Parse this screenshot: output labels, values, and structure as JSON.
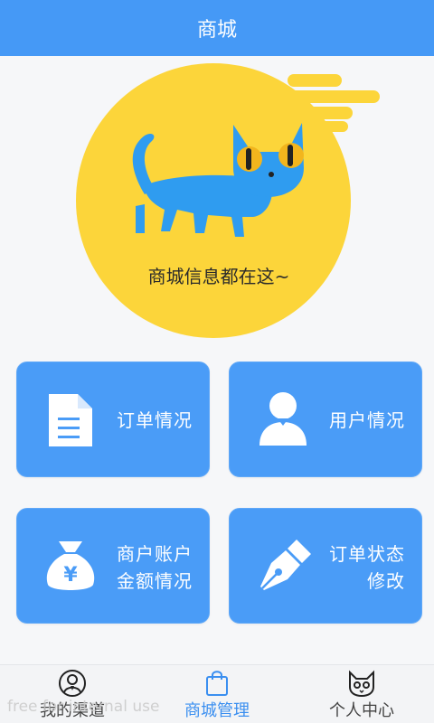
{
  "header": {
    "title": "商城"
  },
  "hero": {
    "caption": "商城信息都在这~"
  },
  "cards": [
    {
      "id": "orders",
      "icon": "document-icon",
      "lines": [
        "订单情况"
      ]
    },
    {
      "id": "users",
      "icon": "user-icon",
      "lines": [
        "用户情况"
      ]
    },
    {
      "id": "merchant",
      "icon": "money-bag-icon",
      "lines": [
        "商户账户",
        "金额情况"
      ]
    },
    {
      "id": "order-status",
      "icon": "pen-nib-icon",
      "lines": [
        "订单状态",
        "修改"
      ]
    }
  ],
  "tabbar": {
    "tabs": [
      {
        "label": "我的渠道",
        "icon": "agent-avatar-icon",
        "active": false
      },
      {
        "label": "商城管理",
        "icon": "shopping-bag-icon",
        "active": true
      },
      {
        "label": "个人中心",
        "icon": "cat-face-icon",
        "active": false
      }
    ]
  },
  "watermark": "free for internal use",
  "colors": {
    "primary": "#4599f6",
    "card": "#4a9cf7",
    "hero_circle": "#fcd53a",
    "cat": "#2f9cf0"
  }
}
